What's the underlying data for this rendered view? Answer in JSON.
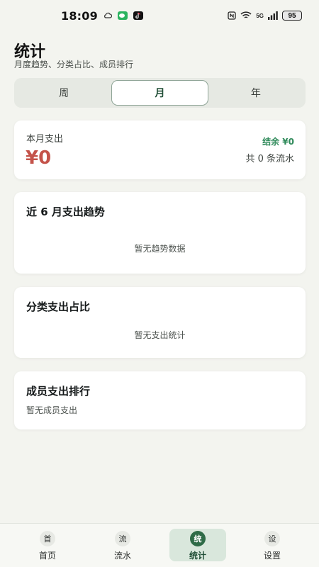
{
  "status_bar": {
    "time": "18:09",
    "net_label": "5G",
    "battery": "95",
    "icons": [
      "cloud-icon",
      "wechat-icon",
      "tiktok-icon",
      "nfc-icon",
      "wifi-icon",
      "signal-icon",
      "battery-icon"
    ]
  },
  "header": {
    "title": "统计",
    "subtitle": "月度趋势、分类占比、成员排行"
  },
  "period_tabs": [
    {
      "label": "周",
      "active": false
    },
    {
      "label": "月",
      "active": true
    },
    {
      "label": "年",
      "active": false
    }
  ],
  "summary": {
    "label": "本月支出",
    "amount": "¥0",
    "balance": "结余 ¥0",
    "count": "共 0 条流水"
  },
  "trend_card": {
    "title": "近 6 月支出趋势",
    "empty_text": "暂无趋势数据"
  },
  "category_card": {
    "title": "分类支出占比",
    "empty_text": "暂无支出统计"
  },
  "members_card": {
    "title": "成员支出排行",
    "empty_text": "暂无成员支出"
  },
  "bottom_nav": [
    {
      "badge": "首",
      "label": "首页",
      "active": false
    },
    {
      "badge": "流",
      "label": "流水",
      "active": false
    },
    {
      "badge": "统",
      "label": "统计",
      "active": true
    },
    {
      "badge": "设",
      "label": "设置",
      "active": false
    }
  ],
  "colors": {
    "accent": "#2e6b47",
    "expense": "#c4534a",
    "balance": "#2f8a5a",
    "background": "#f3f4ef"
  }
}
